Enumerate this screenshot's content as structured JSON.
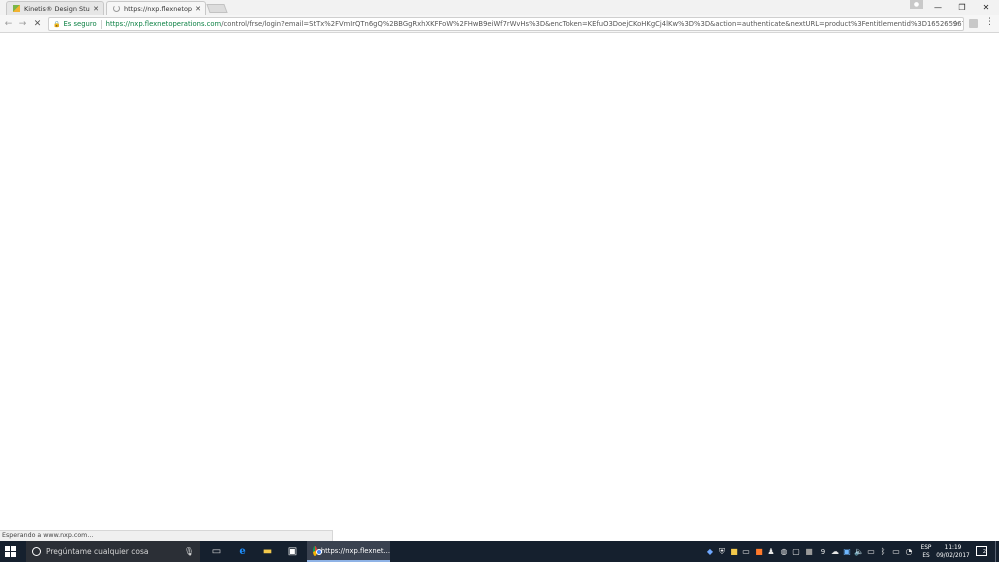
{
  "browser": {
    "tabs": [
      {
        "label": "Kinetis® Design Studio",
        "icon": "kinetis-favicon"
      },
      {
        "label": "https://nxp.flexnetoperations.com",
        "icon": "loading-spinner"
      }
    ],
    "window_controls": {
      "minimize": "—",
      "restore": "❐",
      "close": "✕"
    },
    "toolbar": {
      "back": "←",
      "forward": "→",
      "stop": "✕",
      "security_label": "Es seguro",
      "url_scheme_host": "https://nxp.flexnetoperations.com",
      "url_rest": "/control/frse/login?email=StTx%2FVmIrQTn6gQ%2BBGgRxhXKFFoW%2FHwB9eiWf7rWvHs%3D&encToken=KEfuO3DoejCKoHKgCj4lKw%3D%3D&action=authenticate&nextURL=product%3Fentitlementid%3D165265967%26lineNu",
      "star": "☆",
      "menu": "⋮"
    },
    "status_text": "Esperando a www.nxp.com..."
  },
  "taskbar": {
    "search_placeholder": "Pregúntame cualquier cosa",
    "active_app_label": "https://nxp.flexnet...",
    "language": [
      "ESP",
      "ES"
    ],
    "time": "11:19",
    "date": "09/02/2017",
    "notification_count": "2",
    "tray_number": "9"
  }
}
